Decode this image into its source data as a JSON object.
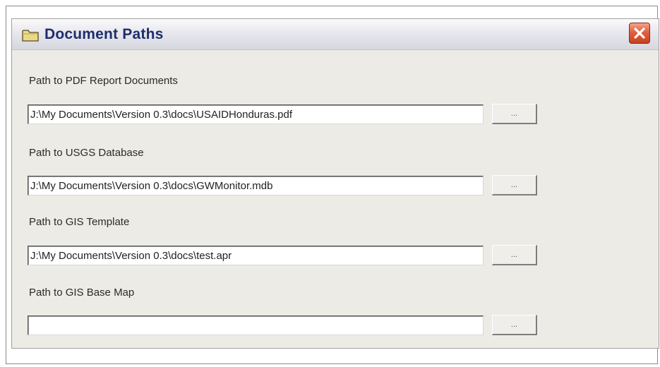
{
  "window": {
    "title": "Document Paths",
    "icon": "folder-icon",
    "close_icon": "close-icon"
  },
  "fields": [
    {
      "label": "Path to PDF Report Documents",
      "value": "J:\\My Documents\\Version 0.3\\docs\\USAIDHonduras.pdf",
      "browse_label": "..."
    },
    {
      "label": "Path to USGS Database",
      "value": "J:\\My Documents\\Version 0.3\\docs\\GWMonitor.mdb",
      "browse_label": "..."
    },
    {
      "label": "Path to GIS Template",
      "value": "J:\\My Documents\\Version 0.3\\docs\\test.apr",
      "browse_label": "..."
    },
    {
      "label": "Path to GIS Base Map",
      "value": "",
      "browse_label": "..."
    }
  ],
  "colors": {
    "title_text": "#1f2e6b",
    "dialog_background": "#ecebe6",
    "close_button": "#e2603f",
    "folder": "#e9d98a"
  }
}
